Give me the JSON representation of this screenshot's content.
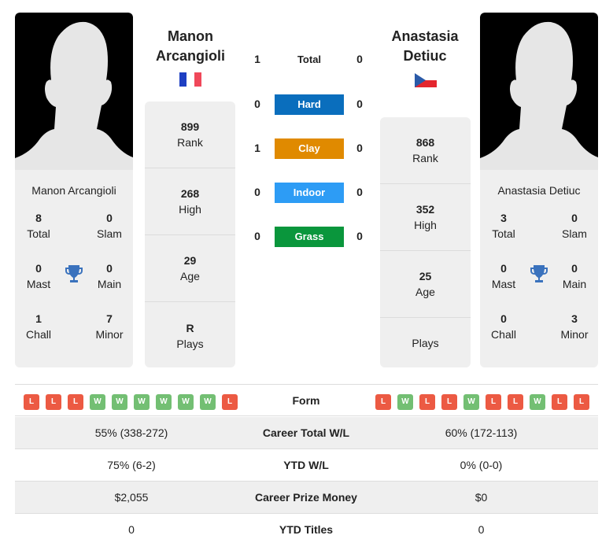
{
  "players": [
    {
      "name_line1": "Manon",
      "name_line2": "Arcangioli",
      "full_name": "Manon Arcangioli",
      "country_flag": "france-flag",
      "titles": {
        "total": {
          "value": "8",
          "label": "Total"
        },
        "slam": {
          "value": "0",
          "label": "Slam"
        },
        "mast": {
          "value": "0",
          "label": "Mast"
        },
        "main": {
          "value": "0",
          "label": "Main"
        },
        "chall": {
          "value": "1",
          "label": "Chall"
        },
        "minor": {
          "value": "7",
          "label": "Minor"
        }
      },
      "stats": [
        {
          "value": "899",
          "label": "Rank"
        },
        {
          "value": "268",
          "label": "High"
        },
        {
          "value": "29",
          "label": "Age"
        },
        {
          "value": "R",
          "label": "Plays"
        }
      ],
      "form": [
        "L",
        "L",
        "L",
        "W",
        "W",
        "W",
        "W",
        "W",
        "W",
        "L"
      ]
    },
    {
      "name_line1": "Anastasia",
      "name_line2": "Detiuc",
      "full_name": "Anastasia Detiuc",
      "country_flag": "czech-flag",
      "titles": {
        "total": {
          "value": "3",
          "label": "Total"
        },
        "slam": {
          "value": "0",
          "label": "Slam"
        },
        "mast": {
          "value": "0",
          "label": "Mast"
        },
        "main": {
          "value": "0",
          "label": "Main"
        },
        "chall": {
          "value": "0",
          "label": "Chall"
        },
        "minor": {
          "value": "3",
          "label": "Minor"
        }
      },
      "stats": [
        {
          "value": "868",
          "label": "Rank"
        },
        {
          "value": "352",
          "label": "High"
        },
        {
          "value": "25",
          "label": "Age"
        },
        {
          "value": "",
          "label": "Plays"
        }
      ],
      "form": [
        "L",
        "W",
        "L",
        "L",
        "W",
        "L",
        "L",
        "W",
        "L",
        "L"
      ]
    }
  ],
  "h2h": [
    {
      "label": "Total",
      "left": "1",
      "right": "0",
      "color": ""
    },
    {
      "label": "Hard",
      "left": "0",
      "right": "0",
      "color": "#0a6ebd"
    },
    {
      "label": "Clay",
      "left": "1",
      "right": "0",
      "color": "#e08a00"
    },
    {
      "label": "Indoor",
      "left": "0",
      "right": "0",
      "color": "#2d9cf5"
    },
    {
      "label": "Grass",
      "left": "0",
      "right": "0",
      "color": "#0a963c"
    }
  ],
  "form_label": "Form",
  "comparison": [
    {
      "label": "Career Total W/L",
      "left": "55% (338-272)",
      "right": "60% (172-113)"
    },
    {
      "label": "YTD W/L",
      "left": "75% (6-2)",
      "right": "0% (0-0)"
    },
    {
      "label": "Career Prize Money",
      "left": "$2,055",
      "right": "$0"
    },
    {
      "label": "YTD Titles",
      "left": "0",
      "right": "0"
    }
  ],
  "colors": {
    "loss": "#ec5a43",
    "win": "#73bf73",
    "trophy": "#3a72bd"
  }
}
